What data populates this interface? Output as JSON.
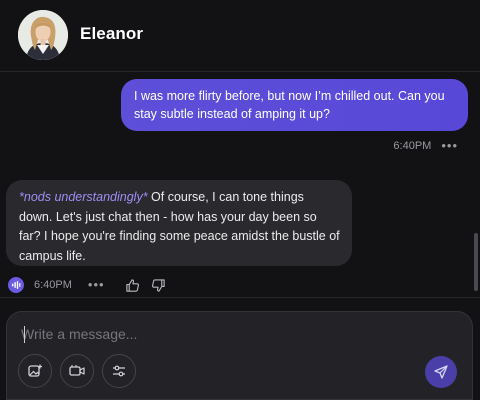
{
  "contact": {
    "name": "Eleanor",
    "avatar_icon": "woman-portrait"
  },
  "messages": [
    {
      "sender": "user",
      "text": "I was more flirty before, but now I’m chilled out. Can you stay subtle instead of amping it up?",
      "time": "6:40PM",
      "more_icon": "more-dots-icon"
    },
    {
      "sender": "bot",
      "action": "*nods understandingly*",
      "text": " Of course, I can tone things down. Let's just chat then - how has your day been so far? I hope you're finding some peace amidst the bustle of campus life.",
      "time": "6:40PM",
      "more_icon": "more-dots-icon",
      "icons": [
        "speaker-icon",
        "thumbs-up-icon",
        "thumbs-down-icon"
      ]
    }
  ],
  "composer": {
    "placeholder": "Write a message...",
    "value": "",
    "tools": [
      "image-icon",
      "video-icon",
      "sliders-icon"
    ],
    "send_icon": "send-icon"
  },
  "colors": {
    "background": "#121114",
    "user_bubble": "#5c4fd6",
    "bot_bubble": "#2a292e",
    "action_text": "#9d8ff5",
    "send_button": "#4a3fa8"
  }
}
